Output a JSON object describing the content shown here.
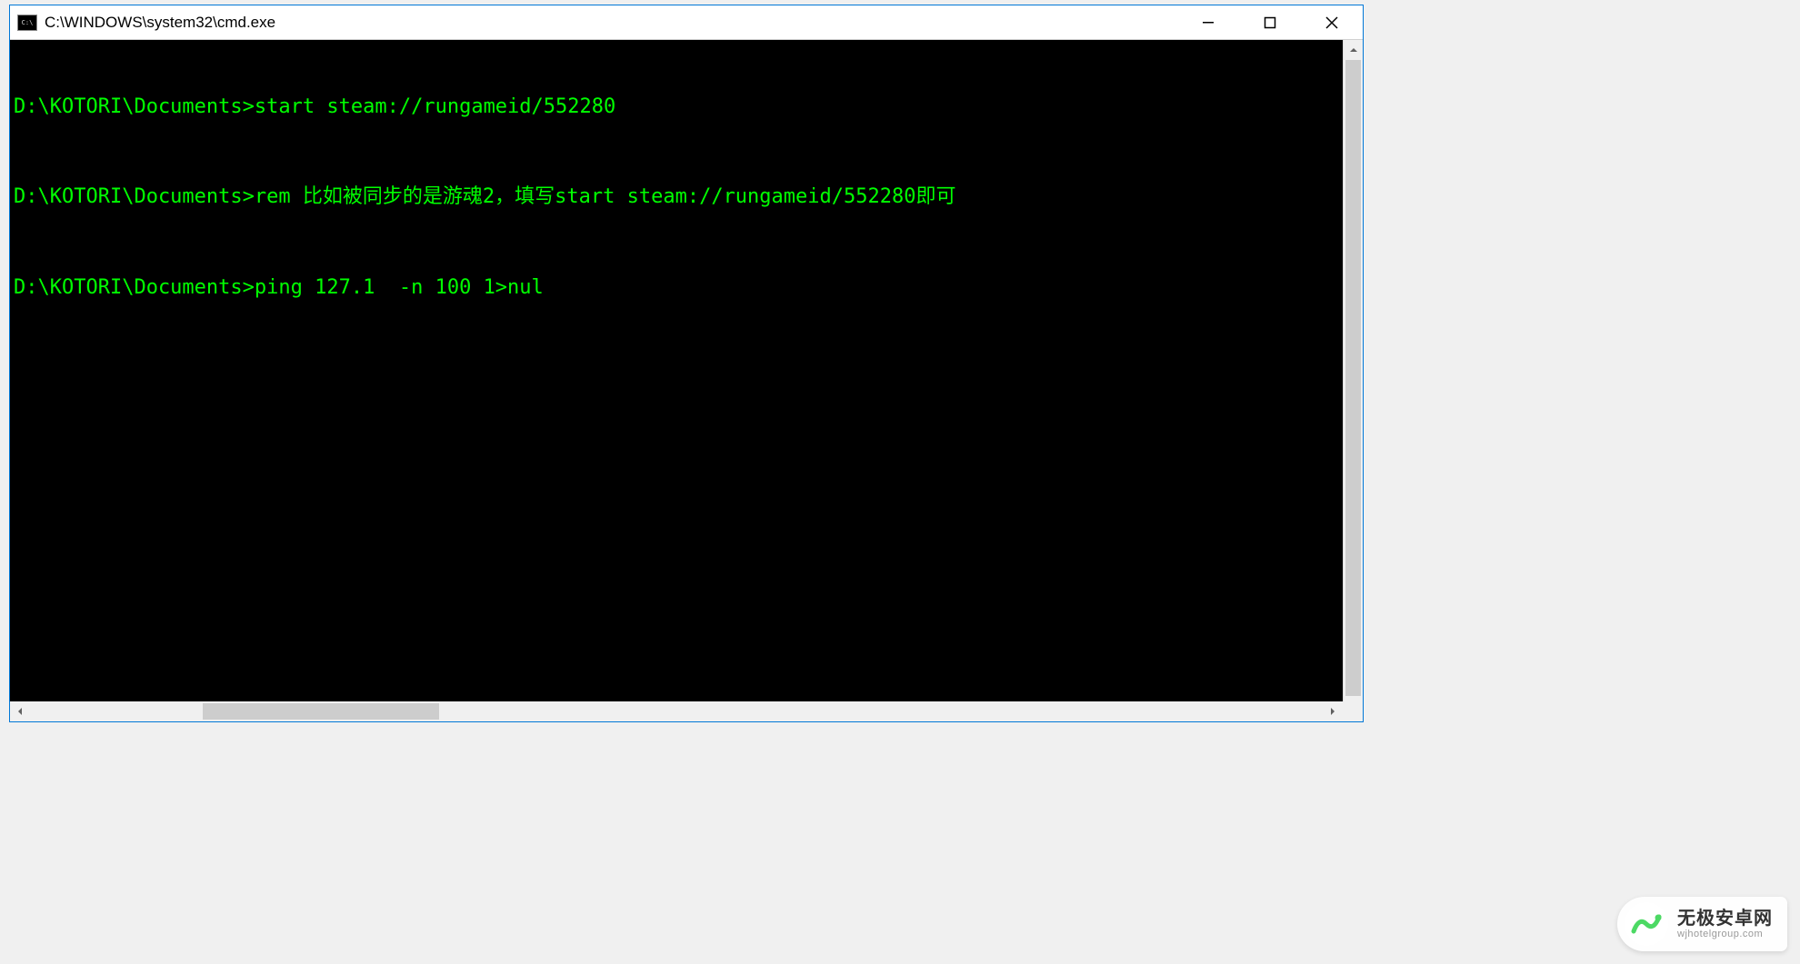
{
  "window": {
    "title": "C:\\WINDOWS\\system32\\cmd.exe"
  },
  "terminal": {
    "lines": [
      {
        "prompt": "D:\\KOTORI\\Documents>",
        "command": "start steam://rungameid/552280"
      },
      {
        "prompt": "D:\\KOTORI\\Documents>",
        "command": "rem 比如被同步的是游魂2，填写start steam://rungameid/552280即可"
      },
      {
        "prompt": "D:\\KOTORI\\Documents>",
        "command": "ping 127.1  -n 100 1>nul"
      }
    ]
  },
  "watermark": {
    "title": "无极安卓网",
    "url": "wjhotelgroup.com"
  }
}
